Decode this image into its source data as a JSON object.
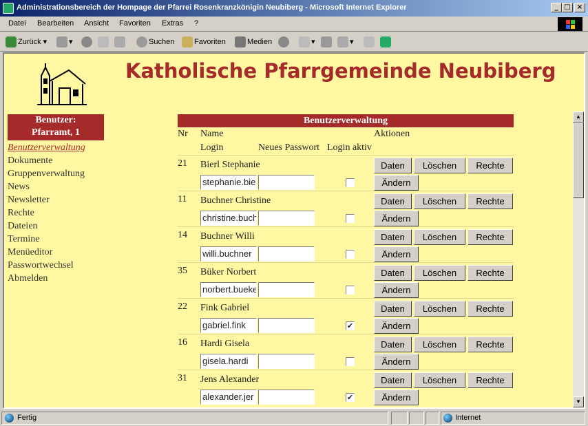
{
  "window": {
    "title": "Administrationsbereich der Hompage der Pfarrei Rosenkranzkönigin Neubiberg - Microsoft Internet Explorer"
  },
  "menu": [
    "Datei",
    "Bearbeiten",
    "Ansicht",
    "Favoriten",
    "Extras",
    "?"
  ],
  "toolbar": {
    "back": "Zurück",
    "search": "Suchen",
    "favorites": "Favoriten",
    "media": "Medien"
  },
  "page": {
    "heading": "Katholische Pfarrgemeinde Neubiberg",
    "user_box": {
      "line1": "Benutzer:",
      "line2": "Pfarramt, 1"
    },
    "nav": [
      "Benutzerverwaltung",
      "Dokumente",
      "Gruppenverwaltung",
      "News",
      "Newsletter",
      "Rechte",
      "Dateien",
      "Termine",
      "Menüeditor",
      "Passwortwechsel",
      "Abmelden"
    ],
    "table": {
      "title": "Benutzerverwaltung",
      "headers": {
        "nr": "Nr",
        "name": "Name",
        "aktionen": "Aktionen",
        "login": "Login",
        "password": "Neues Passwort",
        "login_active": "Login aktiv"
      },
      "buttons": {
        "daten": "Daten",
        "loeschen": "Löschen",
        "rechte": "Rechte",
        "aendern": "Ändern"
      },
      "rows": [
        {
          "nr": "21",
          "name": "Bierl Stephanie",
          "login": "stephanie.bie",
          "active": ""
        },
        {
          "nr": "11",
          "name": "Buchner Christine",
          "login": "christine.buch",
          "active": ""
        },
        {
          "nr": "14",
          "name": "Buchner Willi",
          "login": "willi.buchner",
          "active": ""
        },
        {
          "nr": "35",
          "name": "Büker Norbert",
          "login": "norbert.bueke",
          "active": ""
        },
        {
          "nr": "22",
          "name": "Fink Gabriel",
          "login": "gabriel.fink",
          "active": "✔"
        },
        {
          "nr": "16",
          "name": "Hardi Gisela",
          "login": "gisela.hardi",
          "active": ""
        },
        {
          "nr": "31",
          "name": "Jens Alexander",
          "login": "alexander.jer",
          "active": "✔"
        }
      ]
    }
  },
  "status": {
    "left": "Fertig",
    "zone": "Internet"
  },
  "colors": {
    "page_bg": "#fff7a1",
    "accent": "#a52a2a",
    "titlebar": "#0a246a"
  }
}
